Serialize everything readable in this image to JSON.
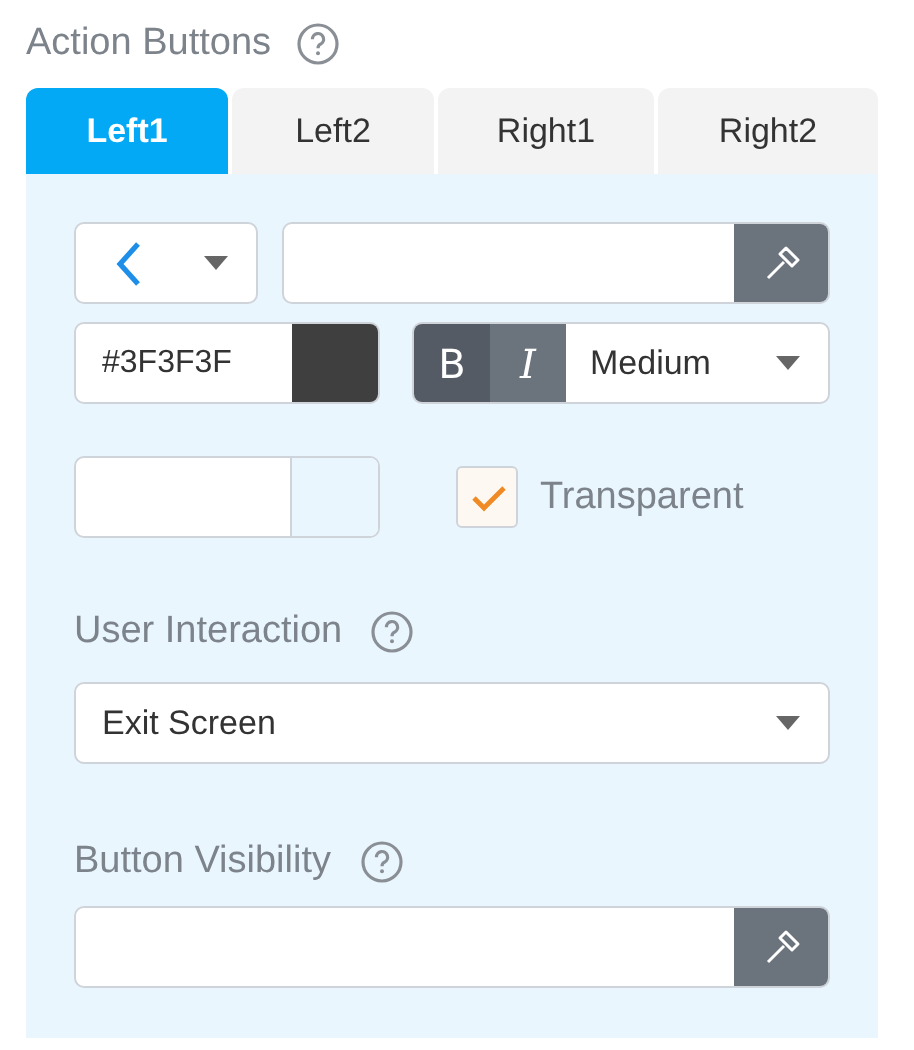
{
  "section_title": "Action Buttons",
  "tabs": [
    {
      "label": "Left1",
      "selected": true
    },
    {
      "label": "Left2",
      "selected": false
    },
    {
      "label": "Right1",
      "selected": false
    },
    {
      "label": "Right2",
      "selected": false
    }
  ],
  "text_color": {
    "value": "#3F3F3F"
  },
  "style_buttons": [
    {
      "label": "B",
      "on": true
    },
    {
      "label": "I",
      "on": false
    }
  ],
  "font_weight": {
    "value": "Medium"
  },
  "transparent": {
    "label": "Transparent",
    "checked": true
  },
  "user_interaction": {
    "label": "User Interaction",
    "value": "Exit Screen"
  },
  "button_visibility": {
    "label": "Button Visibility"
  }
}
